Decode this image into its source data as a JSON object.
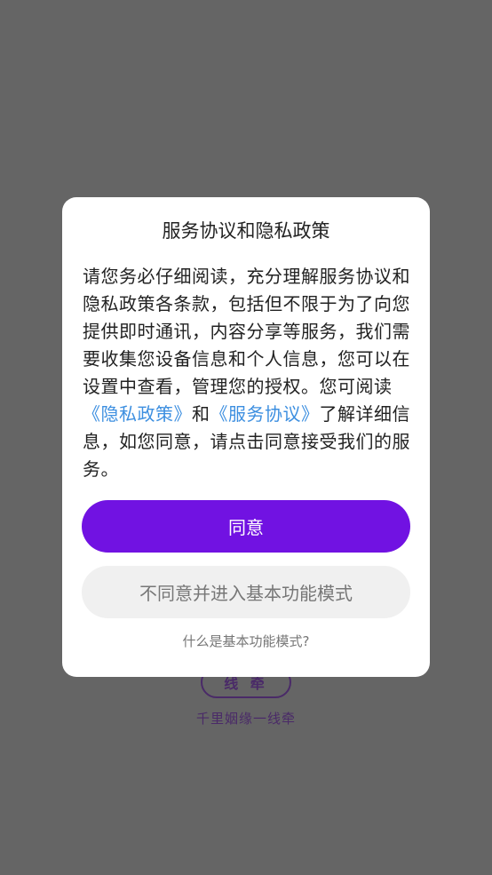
{
  "background": {
    "logo_text": "线 牵",
    "slogan": "千里姻缘一线牵"
  },
  "dialog": {
    "title": "服务协议和隐私政策",
    "body": {
      "text_part1": "请您务必仔细阅读，充分理解服务协议和隐私政策各条款，包括但不限于为了向您提供即时通讯，内容分享等服务，我们需要收集您设备信息和个人信息，您可以在设置中查看，管理您的授权。您可阅读",
      "privacy_link": "《隐私政策》",
      "and": "和",
      "service_link": "《服务协议》",
      "text_part2": "了解详细信息，如您同意，请点击同意接受我们的服务。"
    },
    "agree_button": "同意",
    "disagree_button": "不同意并进入基本功能模式",
    "basic_mode_link": "什么是基本功能模式?"
  },
  "colors": {
    "overlay": "#656565",
    "primary": "#7112e2",
    "link": "#3d8fe0",
    "secondary_button": "#f0f0f0"
  }
}
